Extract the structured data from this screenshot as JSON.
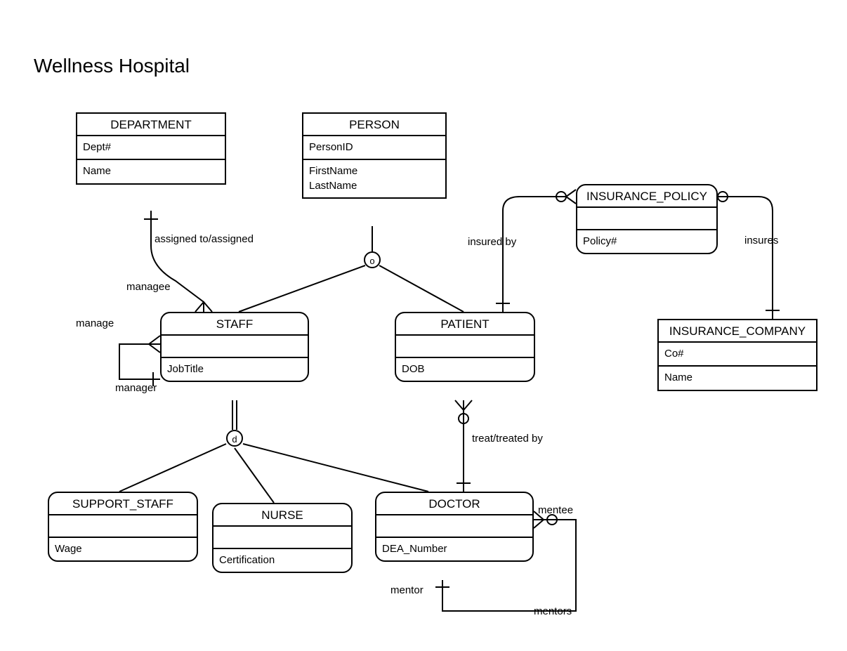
{
  "title": "Wellness Hospital",
  "entities": {
    "department": {
      "name": "DEPARTMENT",
      "key": "Dept#",
      "attrs": [
        "Name"
      ]
    },
    "person": {
      "name": "PERSON",
      "key": "PersonID",
      "attrs": [
        "FirstName",
        "LastName"
      ]
    },
    "insurance_policy": {
      "name": "INSURANCE_POLICY",
      "key": "",
      "attrs": [
        "Policy#"
      ]
    },
    "insurance_company": {
      "name": "INSURANCE_COMPANY",
      "key": "Co#",
      "attrs": [
        "Name"
      ]
    },
    "staff": {
      "name": "STAFF",
      "key": "",
      "attrs": [
        "JobTitle"
      ]
    },
    "patient": {
      "name": "PATIENT",
      "key": "",
      "attrs": [
        "DOB"
      ]
    },
    "support_staff": {
      "name": "SUPPORT_STAFF",
      "key": "",
      "attrs": [
        "Wage"
      ]
    },
    "nurse": {
      "name": "NURSE",
      "key": "",
      "attrs": [
        "Certification"
      ]
    },
    "doctor": {
      "name": "DOCTOR",
      "key": "",
      "attrs": [
        "DEA_Number"
      ]
    }
  },
  "relationships": {
    "assigned": "assigned to/assigned",
    "manage": "manage",
    "managee": "managee",
    "manager": "manager",
    "insured_by": "insured by",
    "insures": "insures",
    "treat": "treat/treated by",
    "mentor": "mentor",
    "mentors": "mentors",
    "mentee": "mentee"
  },
  "specialization": {
    "o": "o",
    "d": "d"
  },
  "chart_data": {
    "type": "er-diagram",
    "title": "Wellness Hospital",
    "entities": [
      {
        "name": "DEPARTMENT",
        "shape": "rect",
        "key_attrs": [
          "Dept#"
        ],
        "other_attrs": [
          "Name"
        ]
      },
      {
        "name": "PERSON",
        "shape": "rect",
        "key_attrs": [
          "PersonID"
        ],
        "other_attrs": [
          "FirstName",
          "LastName"
        ]
      },
      {
        "name": "INSURANCE_POLICY",
        "shape": "rounded",
        "key_attrs": [],
        "other_attrs": [
          "Policy#"
        ]
      },
      {
        "name": "INSURANCE_COMPANY",
        "shape": "rect",
        "key_attrs": [
          "Co#"
        ],
        "other_attrs": [
          "Name"
        ]
      },
      {
        "name": "STAFF",
        "shape": "rounded",
        "key_attrs": [],
        "other_attrs": [
          "JobTitle"
        ]
      },
      {
        "name": "PATIENT",
        "shape": "rounded",
        "key_attrs": [],
        "other_attrs": [
          "DOB"
        ]
      },
      {
        "name": "SUPPORT_STAFF",
        "shape": "rounded",
        "key_attrs": [],
        "other_attrs": [
          "Wage"
        ]
      },
      {
        "name": "NURSE",
        "shape": "rounded",
        "key_attrs": [],
        "other_attrs": [
          "Certification"
        ]
      },
      {
        "name": "DOCTOR",
        "shape": "rounded",
        "key_attrs": [],
        "other_attrs": [
          "DEA_Number"
        ]
      }
    ],
    "specializations": [
      {
        "super": "PERSON",
        "constraint": "o",
        "subs": [
          "STAFF",
          "PATIENT"
        ]
      },
      {
        "super": "STAFF",
        "constraint": "d",
        "subs": [
          "SUPPORT_STAFF",
          "NURSE",
          "DOCTOR"
        ]
      }
    ],
    "relationships": [
      {
        "name": "assigned to/assigned",
        "between": [
          "DEPARTMENT",
          "STAFF"
        ],
        "notation": "crows-foot and bar on STAFF side; bar on DEPARTMENT side"
      },
      {
        "name": "manage",
        "recursive_on": "STAFF",
        "roles": [
          "manager",
          "managee"
        ],
        "notation": "bar on manager side, crows-foot on managee side"
      },
      {
        "name": "insured by",
        "between": [
          "PATIENT",
          "INSURANCE_POLICY"
        ],
        "notation": "bar on PATIENT side; circle+crows-foot on INSURANCE_POLICY side"
      },
      {
        "name": "insures",
        "between": [
          "INSURANCE_POLICY",
          "INSURANCE_COMPANY"
        ],
        "notation": "circle on INSURANCE_POLICY side; bar on INSURANCE_COMPANY side"
      },
      {
        "name": "treat/treated by",
        "between": [
          "DOCTOR",
          "PATIENT"
        ],
        "notation": "bar on DOCTOR side; circle+crows-foot on PATIENT side"
      },
      {
        "name": "mentors",
        "recursive_on": "DOCTOR",
        "roles": [
          "mentor",
          "mentee"
        ],
        "notation": "bar on mentor side; circle+crows-foot on mentee side"
      }
    ]
  }
}
